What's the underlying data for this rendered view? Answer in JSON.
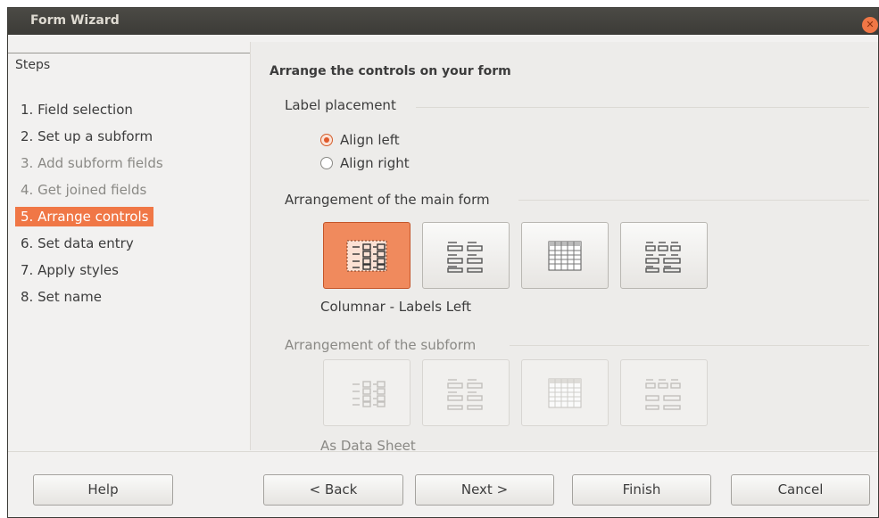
{
  "window": {
    "title": "Form Wizard",
    "close_icon": "close-icon"
  },
  "sidebar": {
    "heading": "Steps",
    "items": [
      {
        "label": "1. Field selection",
        "state": "enabled"
      },
      {
        "label": "2. Set up a subform",
        "state": "enabled"
      },
      {
        "label": "3. Add subform fields",
        "state": "disabled"
      },
      {
        "label": "4. Get joined fields",
        "state": "disabled"
      },
      {
        "label": "5. Arrange controls",
        "state": "active"
      },
      {
        "label": "6. Set data entry",
        "state": "enabled"
      },
      {
        "label": "7. Apply styles",
        "state": "enabled"
      },
      {
        "label": "8. Set name",
        "state": "enabled"
      }
    ]
  },
  "main": {
    "title": "Arrange the controls on your form",
    "label_placement": {
      "heading": "Label placement",
      "options": [
        {
          "label": "Align left",
          "selected": true
        },
        {
          "label": "Align right",
          "selected": false
        }
      ]
    },
    "main_form": {
      "heading": "Arrangement of the main form",
      "options": [
        {
          "icon": "columnar-labels-left-icon",
          "selected": true
        },
        {
          "icon": "columnar-labels-top-icon",
          "selected": false
        },
        {
          "icon": "data-sheet-icon",
          "selected": false
        },
        {
          "icon": "block-labels-above-icon",
          "selected": false
        }
      ],
      "caption": "Columnar - Labels Left"
    },
    "subform": {
      "heading": "Arrangement of the subform",
      "caption": "As Data Sheet"
    }
  },
  "footer": {
    "help": "Help",
    "back": "< Back",
    "next": "Next >",
    "finish": "Finish",
    "cancel": "Cancel"
  },
  "colors": {
    "accent": "#f07746",
    "titlebar": "#3c3b37"
  }
}
